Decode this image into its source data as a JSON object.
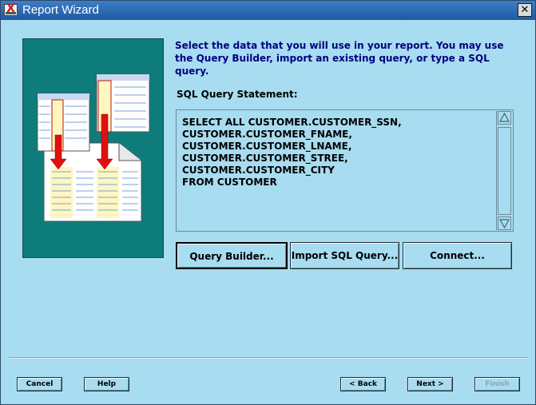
{
  "window": {
    "title": "Report Wizard",
    "close_glyph": "✕"
  },
  "instructions": "Select the data that you will use in your report. You may use the Query Builder, import an existing query, or type a SQL query.",
  "sql": {
    "label": "SQL Query Statement:",
    "query": "SELECT ALL CUSTOMER.CUSTOMER_SSN,\nCUSTOMER.CUSTOMER_FNAME,\nCUSTOMER.CUSTOMER_LNAME,\nCUSTOMER.CUSTOMER_STREE,\nCUSTOMER.CUSTOMER_CITY\nFROM CUSTOMER"
  },
  "query_buttons": {
    "query_builder": "Query Builder...",
    "import_sql": "Import SQL Query...",
    "connect": "Connect..."
  },
  "footer_buttons": {
    "cancel": "Cancel",
    "help": "Help",
    "back": "< Back",
    "next": "Next >",
    "finish": "Finish"
  },
  "colors": {
    "background": "#a8dcf0",
    "illustration_bg": "#0e7c7b",
    "instruction_text": "#000080",
    "arrow": "#e01010"
  },
  "icons": [
    "app-icon",
    "close-icon",
    "scroll-up-icon",
    "scroll-down-icon"
  ]
}
